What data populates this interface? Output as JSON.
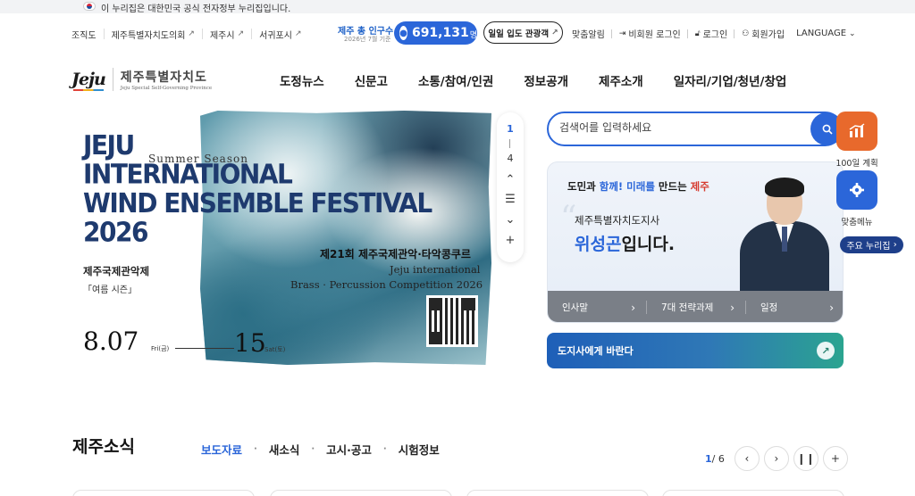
{
  "gov_banner": {
    "text": "이 누리집은 대한민국 공식 전자정부 누리집입니다."
  },
  "util_left": [
    {
      "label": "조직도",
      "ext": false
    },
    {
      "label": "제주특별자치도의회",
      "ext": true
    },
    {
      "label": "제주시",
      "ext": true
    },
    {
      "label": "서귀포시",
      "ext": true
    }
  ],
  "population": {
    "label": "제주 총 인구수",
    "date": "2026년 7월 기준",
    "value": "691,131",
    "unit": "명"
  },
  "tour_button": "일일 입도 관광객",
  "util_right": {
    "alarm": "맞춤알림",
    "guest_login": "비회원 로그인",
    "login": "로그인",
    "join": "회원가입",
    "language": "LANGUAGE"
  },
  "logo": {
    "mark": "Jeju",
    "name_ko": "제주특별자치도",
    "name_en": "Jeju Special Self-Governing Province"
  },
  "gnb": [
    "도정뉴스",
    "신문고",
    "소통/참여/인권",
    "정보공개",
    "제주소개",
    "일자리/기업/청년/창업"
  ],
  "banner": {
    "title_lines": [
      "JEJU",
      "INTERNATIONAL",
      "WIND ENSEMBLE FESTIVAL",
      "2026"
    ],
    "summer": "Summer Season",
    "name_ko": "제주국제관악제",
    "season_ko": "「여름 시즌」",
    "date_start": "8.07",
    "day_start": "Fri(금)",
    "date_end": "15",
    "day_end": "Sat(토)",
    "competition_ko": "제21회 제주국제관악·타악콩쿠르",
    "competition_en1": "Jeju international",
    "competition_en2": "Brass · Percussion Competition 2026"
  },
  "pager": {
    "current": "1",
    "total": "4"
  },
  "search": {
    "placeholder": "검색어를 입력하세요"
  },
  "governor": {
    "slogan_1": "도민과 ",
    "slogan_2": "함께!",
    "slogan_3": " 미래를",
    "slogan_4": " 만드는 ",
    "slogan_5": "제주",
    "role": "제주특별자치도지사",
    "name": "위성곤",
    "name_suffix": "입니다.",
    "links": [
      "인사말",
      "7대 전략과제",
      "일정"
    ]
  },
  "petition": {
    "label": "도지사에게 바란다"
  },
  "quick_menu": [
    {
      "label": "100일 계획",
      "color": "#e8692c",
      "icon": "chart-icon"
    },
    {
      "label": "맞춤메뉴",
      "color": "#2b66d9",
      "icon": "gear-icon"
    }
  ],
  "major_sites": "주요 누리집",
  "news": {
    "title": "제주소식",
    "tabs": [
      "보도자료",
      "새소식",
      "고시·공고",
      "시험정보"
    ],
    "page_current": "1",
    "page_total": "/ 6"
  },
  "colors": {
    "primary": "#2b66d9",
    "accent_orange": "#e8692c",
    "navy": "#1e3f8a"
  }
}
